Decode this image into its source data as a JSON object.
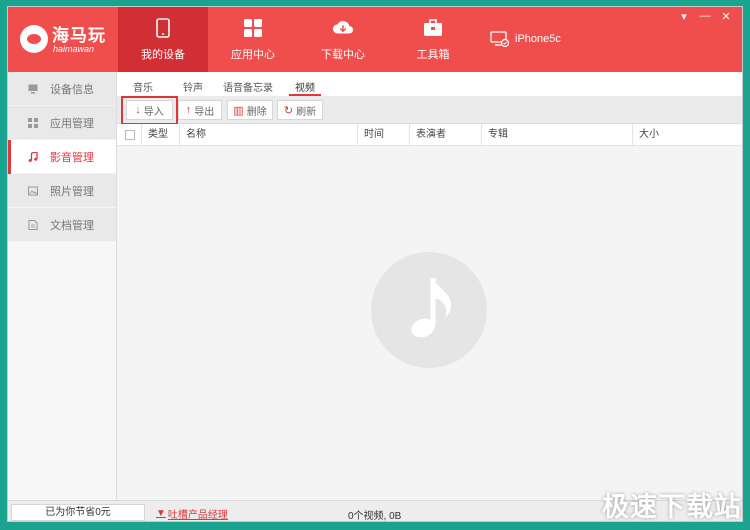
{
  "app": {
    "title": "海马玩",
    "subtitle": "haimawan"
  },
  "nav": [
    {
      "label": "我的设备",
      "icon": "phone-icon",
      "active": true
    },
    {
      "label": "应用中心",
      "icon": "apps-grid-icon"
    },
    {
      "label": "下载中心",
      "icon": "cloud-download-icon"
    },
    {
      "label": "工具箱",
      "icon": "toolbox-icon"
    }
  ],
  "device": {
    "name": "iPhone5c",
    "icon": "device-connected-icon"
  },
  "window_controls": {
    "menu": "▾",
    "minimize": "—",
    "close": "✕"
  },
  "sidebar": [
    {
      "label": "设备信息",
      "icon": "monitor-icon"
    },
    {
      "label": "应用管理",
      "icon": "grid-icon"
    },
    {
      "label": "影音管理",
      "icon": "music-icon",
      "active": true
    },
    {
      "label": "照片管理",
      "icon": "photo-icon"
    },
    {
      "label": "文档管理",
      "icon": "document-icon"
    }
  ],
  "tabs": [
    {
      "label": "音乐"
    },
    {
      "label": "铃声"
    },
    {
      "label": "语音备忘录"
    },
    {
      "label": "视频",
      "active": true
    }
  ],
  "toolbar": {
    "import": "导入",
    "export": "导出",
    "delete": "删除",
    "refresh": "刷新"
  },
  "table": {
    "columns": [
      "类型",
      "名称",
      "时间",
      "表演者",
      "专辑",
      "大小"
    ]
  },
  "status": {
    "saved": "已为你节省0元",
    "feedback": "吐槽产品经理",
    "count": "0个视频, 0B"
  },
  "watermark": "极速下载站",
  "colors": {
    "accent": "#f04d4d",
    "active_nav": "#d22f34",
    "highlight": "#e0363c",
    "background": "#1aa38f"
  }
}
